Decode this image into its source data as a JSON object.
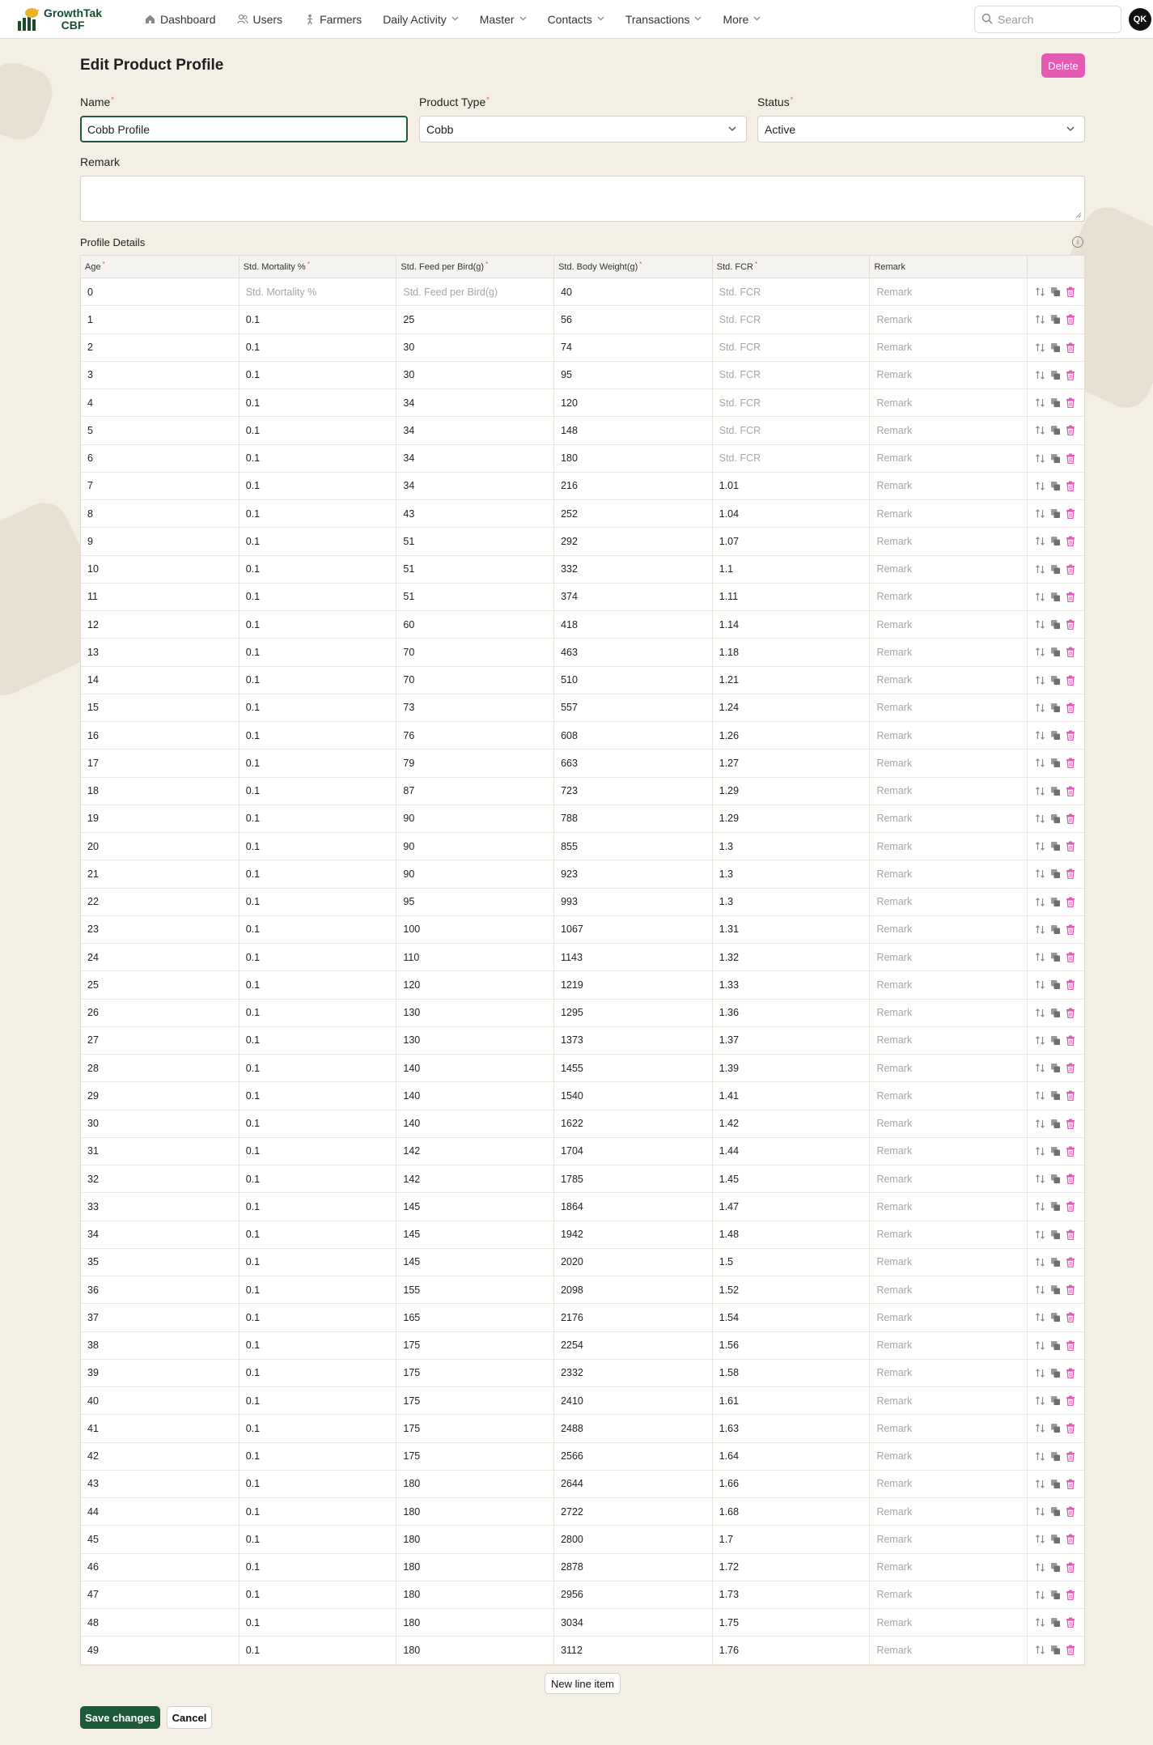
{
  "app": {
    "name_line1": "GrowthTak",
    "name_line2": "CBF"
  },
  "nav": {
    "items": [
      {
        "label": "Dashboard",
        "icon": "home-icon",
        "dropdown": false
      },
      {
        "label": "Users",
        "icon": "users-icon",
        "dropdown": false
      },
      {
        "label": "Farmers",
        "icon": "farmer-icon",
        "dropdown": false
      },
      {
        "label": "Daily Activity",
        "icon": "",
        "dropdown": true
      },
      {
        "label": "Master",
        "icon": "",
        "dropdown": true
      },
      {
        "label": "Contacts",
        "icon": "",
        "dropdown": true
      },
      {
        "label": "Transactions",
        "icon": "",
        "dropdown": true
      },
      {
        "label": "More",
        "icon": "",
        "dropdown": true
      }
    ],
    "search_placeholder": "Search",
    "avatar_initials": "QK"
  },
  "page": {
    "title": "Edit Product Profile",
    "delete_label": "Delete",
    "name_label": "Name",
    "name_value": "Cobb Profile",
    "product_type_label": "Product Type",
    "product_type_value": "Cobb",
    "status_label": "Status",
    "status_value": "Active",
    "remark_label": "Remark",
    "profile_details_label": "Profile Details",
    "new_line_label": "New line item",
    "save_label": "Save changes",
    "cancel_label": "Cancel"
  },
  "table": {
    "headers": [
      "Age",
      "Std. Mortality %",
      "Std. Feed per Bird(g)",
      "Std. Body Weight(g)",
      "Std. FCR",
      "Remark"
    ],
    "required": [
      true,
      true,
      true,
      true,
      true,
      false
    ],
    "placeholders": {
      "mortality": "Std. Mortality %",
      "feed": "Std. Feed per Bird(g)",
      "body_weight": "Std. Body Weight(g)",
      "fcr": "Std. FCR",
      "remark": "Remark"
    },
    "rows": [
      [
        "0",
        "",
        "",
        "40",
        "",
        ""
      ],
      [
        "1",
        "0.1",
        "25",
        "56",
        "",
        ""
      ],
      [
        "2",
        "0.1",
        "30",
        "74",
        "",
        ""
      ],
      [
        "3",
        "0.1",
        "30",
        "95",
        "",
        ""
      ],
      [
        "4",
        "0.1",
        "34",
        "120",
        "",
        ""
      ],
      [
        "5",
        "0.1",
        "34",
        "148",
        "",
        ""
      ],
      [
        "6",
        "0.1",
        "34",
        "180",
        "",
        ""
      ],
      [
        "7",
        "0.1",
        "34",
        "216",
        "1.01",
        ""
      ],
      [
        "8",
        "0.1",
        "43",
        "252",
        "1.04",
        ""
      ],
      [
        "9",
        "0.1",
        "51",
        "292",
        "1.07",
        ""
      ],
      [
        "10",
        "0.1",
        "51",
        "332",
        "1.1",
        ""
      ],
      [
        "11",
        "0.1",
        "51",
        "374",
        "1.11",
        ""
      ],
      [
        "12",
        "0.1",
        "60",
        "418",
        "1.14",
        ""
      ],
      [
        "13",
        "0.1",
        "70",
        "463",
        "1.18",
        ""
      ],
      [
        "14",
        "0.1",
        "70",
        "510",
        "1.21",
        ""
      ],
      [
        "15",
        "0.1",
        "73",
        "557",
        "1.24",
        ""
      ],
      [
        "16",
        "0.1",
        "76",
        "608",
        "1.26",
        ""
      ],
      [
        "17",
        "0.1",
        "79",
        "663",
        "1.27",
        ""
      ],
      [
        "18",
        "0.1",
        "87",
        "723",
        "1.29",
        ""
      ],
      [
        "19",
        "0.1",
        "90",
        "788",
        "1.29",
        ""
      ],
      [
        "20",
        "0.1",
        "90",
        "855",
        "1.3",
        ""
      ],
      [
        "21",
        "0.1",
        "90",
        "923",
        "1.3",
        ""
      ],
      [
        "22",
        "0.1",
        "95",
        "993",
        "1.3",
        ""
      ],
      [
        "23",
        "0.1",
        "100",
        "1067",
        "1.31",
        ""
      ],
      [
        "24",
        "0.1",
        "110",
        "1143",
        "1.32",
        ""
      ],
      [
        "25",
        "0.1",
        "120",
        "1219",
        "1.33",
        ""
      ],
      [
        "26",
        "0.1",
        "130",
        "1295",
        "1.36",
        ""
      ],
      [
        "27",
        "0.1",
        "130",
        "1373",
        "1.37",
        ""
      ],
      [
        "28",
        "0.1",
        "140",
        "1455",
        "1.39",
        ""
      ],
      [
        "29",
        "0.1",
        "140",
        "1540",
        "1.41",
        ""
      ],
      [
        "30",
        "0.1",
        "140",
        "1622",
        "1.42",
        ""
      ],
      [
        "31",
        "0.1",
        "142",
        "1704",
        "1.44",
        ""
      ],
      [
        "32",
        "0.1",
        "142",
        "1785",
        "1.45",
        ""
      ],
      [
        "33",
        "0.1",
        "145",
        "1864",
        "1.47",
        ""
      ],
      [
        "34",
        "0.1",
        "145",
        "1942",
        "1.48",
        ""
      ],
      [
        "35",
        "0.1",
        "145",
        "2020",
        "1.5",
        ""
      ],
      [
        "36",
        "0.1",
        "155",
        "2098",
        "1.52",
        ""
      ],
      [
        "37",
        "0.1",
        "165",
        "2176",
        "1.54",
        ""
      ],
      [
        "38",
        "0.1",
        "175",
        "2254",
        "1.56",
        ""
      ],
      [
        "39",
        "0.1",
        "175",
        "2332",
        "1.58",
        ""
      ],
      [
        "40",
        "0.1",
        "175",
        "2410",
        "1.61",
        ""
      ],
      [
        "41",
        "0.1",
        "175",
        "2488",
        "1.63",
        ""
      ],
      [
        "42",
        "0.1",
        "175",
        "2566",
        "1.64",
        ""
      ],
      [
        "43",
        "0.1",
        "180",
        "2644",
        "1.66",
        ""
      ],
      [
        "44",
        "0.1",
        "180",
        "2722",
        "1.68",
        ""
      ],
      [
        "45",
        "0.1",
        "180",
        "2800",
        "1.7",
        ""
      ],
      [
        "46",
        "0.1",
        "180",
        "2878",
        "1.72",
        ""
      ],
      [
        "47",
        "0.1",
        "180",
        "2956",
        "1.73",
        ""
      ],
      [
        "48",
        "0.1",
        "180",
        "3034",
        "1.75",
        ""
      ],
      [
        "49",
        "0.1",
        "180",
        "3112",
        "1.76",
        ""
      ]
    ]
  },
  "colors": {
    "accent": "#1e5a3a",
    "danger": "#e35bb3",
    "background": "#f4efe4"
  }
}
